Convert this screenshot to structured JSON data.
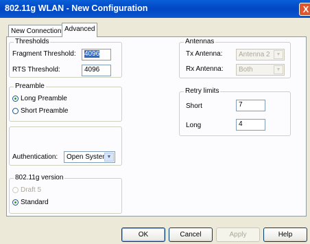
{
  "window": {
    "title": "802.11g WLAN - New Configuration",
    "close_glyph": "X"
  },
  "tabs": [
    {
      "label": "New Connection"
    },
    {
      "label": "Advanced"
    }
  ],
  "thresholds": {
    "legend": "Thresholds",
    "fragment_label": "Fragment Threshold:",
    "fragment_value": "4096",
    "rts_label": "RTS Threshold:",
    "rts_value": "4096"
  },
  "preamble": {
    "legend": "Preamble",
    "long_label": "Long Preamble",
    "short_label": "Short Preamble",
    "selected": "long"
  },
  "authentication": {
    "label": "Authentication:",
    "value": "Open System"
  },
  "version": {
    "legend": "802.11g version",
    "draft_label": "Draft 5",
    "standard_label": "Standard",
    "selected": "standard"
  },
  "antennas": {
    "legend": "Antennas",
    "tx_label": "Tx Antenna:",
    "tx_value": "Antenna 2",
    "rx_label": "Rx Antenna:",
    "rx_value": "Both"
  },
  "retry": {
    "legend": "Retry limits",
    "short_label": "Short",
    "short_value": "7",
    "long_label": "Long",
    "long_value": "4"
  },
  "buttons": {
    "ok": "OK",
    "cancel": "Cancel",
    "apply": "Apply",
    "help": "Help"
  }
}
